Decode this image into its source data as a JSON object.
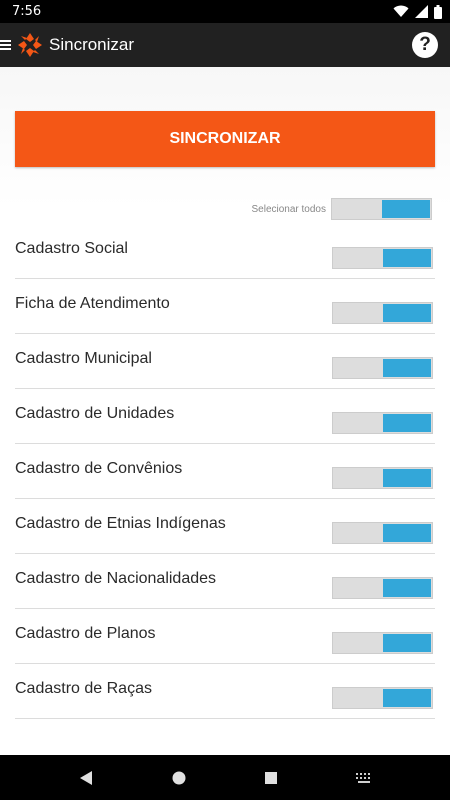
{
  "status_bar": {
    "time": "7:56",
    "icons": [
      "wifi-icon",
      "signal-icon",
      "battery-icon"
    ]
  },
  "app_bar": {
    "title": "Sincronizar",
    "icons": [
      "menu-icon",
      "app-logo-icon",
      "help-icon"
    ],
    "help_glyph": "?"
  },
  "sync": {
    "button_label": "SINCRONIZAR"
  },
  "select_all": {
    "label": "Selecionar todos",
    "checked": true
  },
  "items": [
    {
      "label": "Cadastro Social",
      "checked": true
    },
    {
      "label": "Ficha de Atendimento",
      "checked": true
    },
    {
      "label": "Cadastro Municipal",
      "checked": true
    },
    {
      "label": "Cadastro de Unidades",
      "checked": true
    },
    {
      "label": "Cadastro de Convênios",
      "checked": true
    },
    {
      "label": "Cadastro de Etnias Indígenas",
      "checked": true
    },
    {
      "label": "Cadastro de Nacionalidades",
      "checked": true
    },
    {
      "label": "Cadastro de Planos",
      "checked": true
    },
    {
      "label": "Cadastro de Raças",
      "checked": true
    }
  ],
  "colors": {
    "accent": "#f45716",
    "toggle_on": "#33a7d9",
    "toggle_off": "#dddddd",
    "app_bar": "#212121"
  },
  "nav_bar": {
    "icons": [
      "back-icon",
      "home-icon",
      "recents-icon",
      "keyboard-icon"
    ]
  }
}
